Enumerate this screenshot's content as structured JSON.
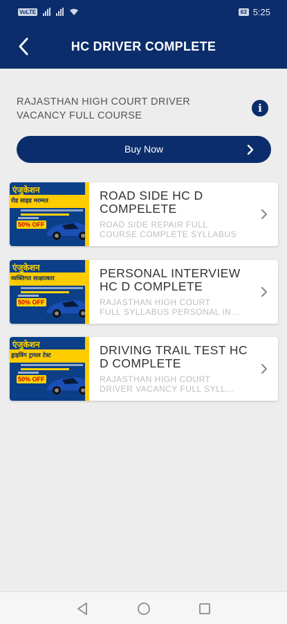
{
  "status_bar": {
    "left_chip": "VoLTE",
    "battery": "63",
    "time": "5:25"
  },
  "header": {
    "title": "HC DRIVER COMPLETE"
  },
  "course": {
    "title": "RAJASTHAN HIGH COURT DRIVER VACANCY FULL COURSE",
    "buy_label": "Buy Now"
  },
  "thumbnail": {
    "brand": "एंजुकेशन",
    "discount_badge": "50% OFF"
  },
  "items": [
    {
      "title": "ROAD SIDE HC D COMPELETE",
      "subtitle": "ROAD SIDE REPAIR FULL\nCOURSE COMPLETE SYLLABUS",
      "thumb_ribbon": "रोड साइड मरम्मत"
    },
    {
      "title": "PERSONAL INTERVIEW HC D COMPLETE",
      "subtitle": "RAJASTHAN HIGH COURT\nFULL SYLLABUS PERSONAL IN...",
      "thumb_ribbon": "व्यक्तिगत साक्षात्कार"
    },
    {
      "title": "DRIVING TRAIL TEST HC D COMPLETE",
      "subtitle": "RAJASTHAN HIGH COURT\nDRIVER VACANCY FULL SYLL...",
      "thumb_ribbon": "ड्राइविंग ट्रायल टेस्ट"
    }
  ],
  "colors": {
    "primary": "#0b2d6b",
    "background": "#ededed",
    "thumb_blue": "#0c3f88",
    "thumb_yellow": "#ffcc00"
  },
  "icons": {
    "back": "arrow-back-icon",
    "info": "info-icon",
    "chevron": "chevron-right-icon",
    "nav_back": "nav-back-icon",
    "nav_home": "nav-home-icon",
    "nav_recents": "nav-recents-icon"
  },
  "info_glyph": "i"
}
